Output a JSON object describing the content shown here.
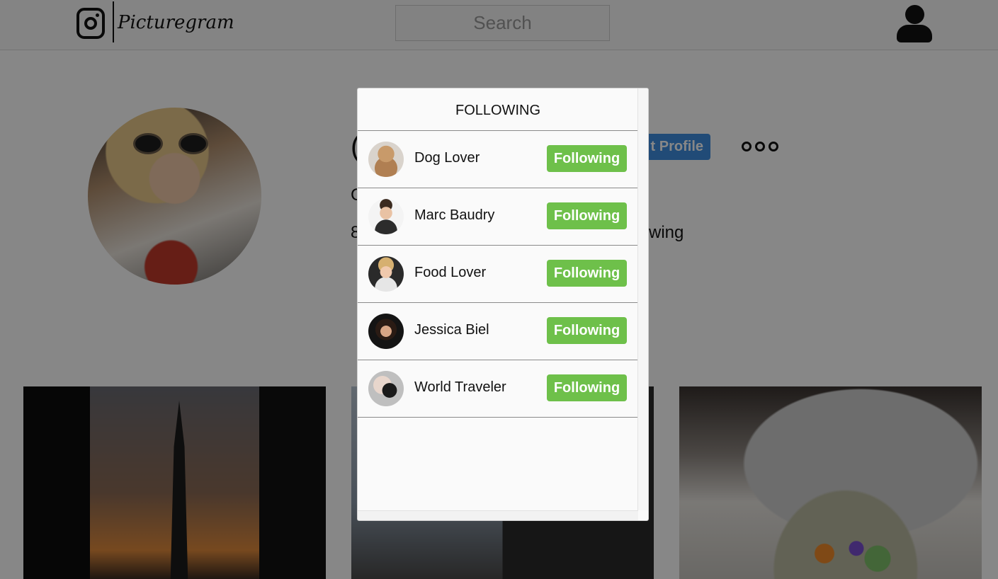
{
  "header": {
    "brand": "Picturegram",
    "search_placeholder": "Search"
  },
  "profile": {
    "name_partial": "(",
    "edit_label_partial": "t Profile",
    "line1_partial": "C",
    "line2_partial": "8",
    "following_partial": "wing"
  },
  "modal": {
    "title": "FOLLOWING",
    "items": [
      {
        "name": "Dog Lover",
        "button": "Following"
      },
      {
        "name": "Marc Baudry",
        "button": "Following"
      },
      {
        "name": "Food Lover",
        "button": "Following"
      },
      {
        "name": "Jessica Biel",
        "button": "Following"
      },
      {
        "name": "World Traveler",
        "button": "Following"
      }
    ]
  },
  "colors": {
    "following_button": "#6ec04a",
    "edit_profile_button": "#3f8fe0",
    "overlay": "rgba(0,0,0,0.47)"
  }
}
